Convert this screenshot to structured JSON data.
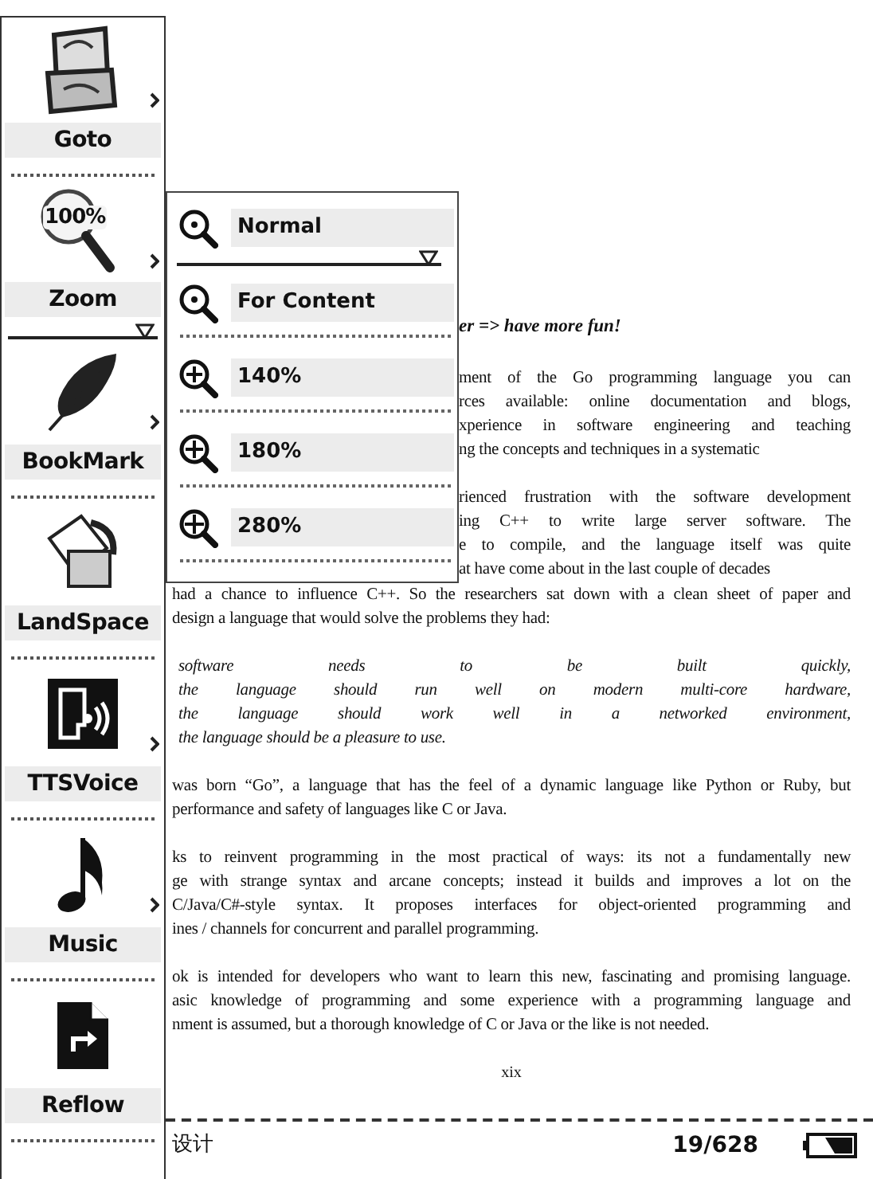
{
  "menu": {
    "items": [
      {
        "label": "Goto",
        "submenu": true,
        "selected": false
      },
      {
        "label": "Zoom",
        "submenu": true,
        "selected": true,
        "icon_text": "100%"
      },
      {
        "label": "BookMark",
        "submenu": true,
        "selected": false
      },
      {
        "label": "LandSpace",
        "submenu": false,
        "selected": false
      },
      {
        "label": "TTSVoice",
        "submenu": true,
        "selected": false
      },
      {
        "label": "Music",
        "submenu": true,
        "selected": false
      },
      {
        "label": "Reflow",
        "submenu": false,
        "selected": false
      }
    ]
  },
  "zoom_menu": {
    "items": [
      {
        "label": "Normal",
        "selected": true
      },
      {
        "label": "For Content",
        "selected": false
      },
      {
        "label": "140%",
        "selected": false
      },
      {
        "label": "180%",
        "selected": false
      },
      {
        "label": "280%",
        "selected": false
      }
    ]
  },
  "page": {
    "heading": "er => have more fun!",
    "upper_paragraphs": [
      {
        "kind": "prose",
        "lines": [
          "ment of the Go programming language you can",
          "rces available: online documentation and blogs,",
          "xperience in software engineering and teaching",
          "ng the concepts and techniques in a systematic"
        ]
      },
      {
        "kind": "prose",
        "lines": [
          "rienced frustration with the software development",
          "ing C++ to write large server software. The",
          "e to compile, and the language itself was quite",
          "at have come about in the last couple of decades"
        ]
      }
    ],
    "lower_paragraphs": [
      {
        "kind": "prose",
        "lines": [
          "had a chance to influence C++. So the researchers sat down with a clean sheet of paper and",
          "design a language that would solve the problems they had:"
        ]
      },
      {
        "kind": "list",
        "lines": [
          "software needs to be built quickly,",
          "the language should run well on modern multi-core hardware,",
          "the language should work well in a networked environment,",
          "the language should be a pleasure to use."
        ]
      },
      {
        "kind": "prose",
        "lines": [
          "was born “Go”, a language that has the feel of a dynamic language like Python or Ruby, but",
          "performance and safety of languages like C or Java."
        ]
      },
      {
        "kind": "prose",
        "lines": [
          "ks to reinvent programming in the most practical of ways: its not a fundamentally new",
          "ge with strange syntax and arcane concepts; instead it builds and improves a lot on the",
          "C/Java/C#-style syntax. It proposes interfaces for object-oriented programming and",
          "ines / channels for concurrent and parallel programming."
        ]
      },
      {
        "kind": "prose",
        "lines": [
          "ok is intended for developers who want to learn this new, fascinating and promising language.",
          "asic knowledge of programming and some experience with a programming language and",
          "nment is assumed, but a thorough knowledge of C or Java or the like is not needed."
        ]
      }
    ],
    "page_number": "xix"
  },
  "status_bar": {
    "title": "设计",
    "page": "19/628"
  }
}
